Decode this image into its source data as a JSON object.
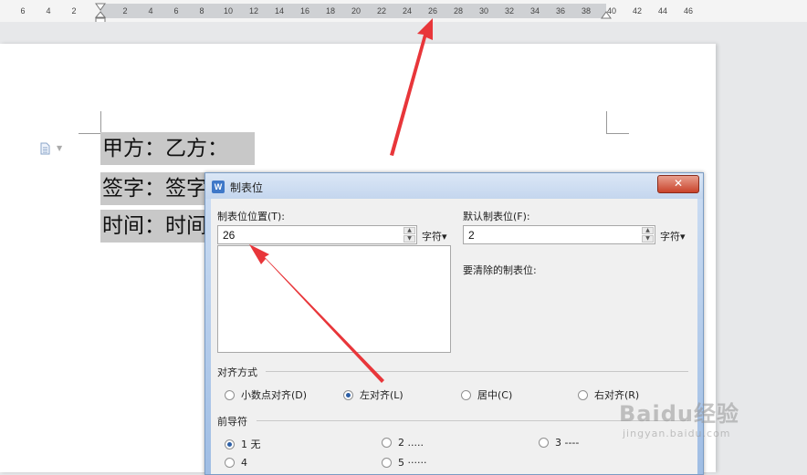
{
  "ruler": {
    "labels": [
      "6",
      "4",
      "2",
      "2",
      "4",
      "6",
      "8",
      "10",
      "12",
      "14",
      "16",
      "18",
      "20",
      "22",
      "24",
      "26",
      "28",
      "30",
      "32",
      "34",
      "36",
      "38",
      "40",
      "42",
      "44",
      "46"
    ]
  },
  "document": {
    "lines": [
      "甲方：乙方：",
      "签字：签字：",
      "时间：时间："
    ]
  },
  "dialog": {
    "title": "制表位",
    "logo": "W",
    "close_label": "✕",
    "tab_position_label": "制表位位置(T):",
    "tab_position_value": "26",
    "default_tab_label": "默认制表位(F):",
    "default_tab_value": "2",
    "unit_label": "字符▾",
    "clear_label": "要清除的制表位:",
    "alignment": {
      "title": "对齐方式",
      "options": [
        "小数点对齐(D)",
        "左对齐(L)",
        "居中(C)",
        "右对齐(R)"
      ],
      "selected": "左对齐(L)"
    },
    "leader": {
      "title": "前导符",
      "options": [
        "1 无",
        "2 .....",
        "3 ----",
        "4",
        "5 ······"
      ],
      "selected": "1 无"
    }
  },
  "watermark": {
    "main": "Baidu经验",
    "sub": "jingyan.baidu.com"
  },
  "colors": {
    "arrow": "#e8363a",
    "selection": "#c8c8c8",
    "radio_dot": "#2d5fa6"
  }
}
